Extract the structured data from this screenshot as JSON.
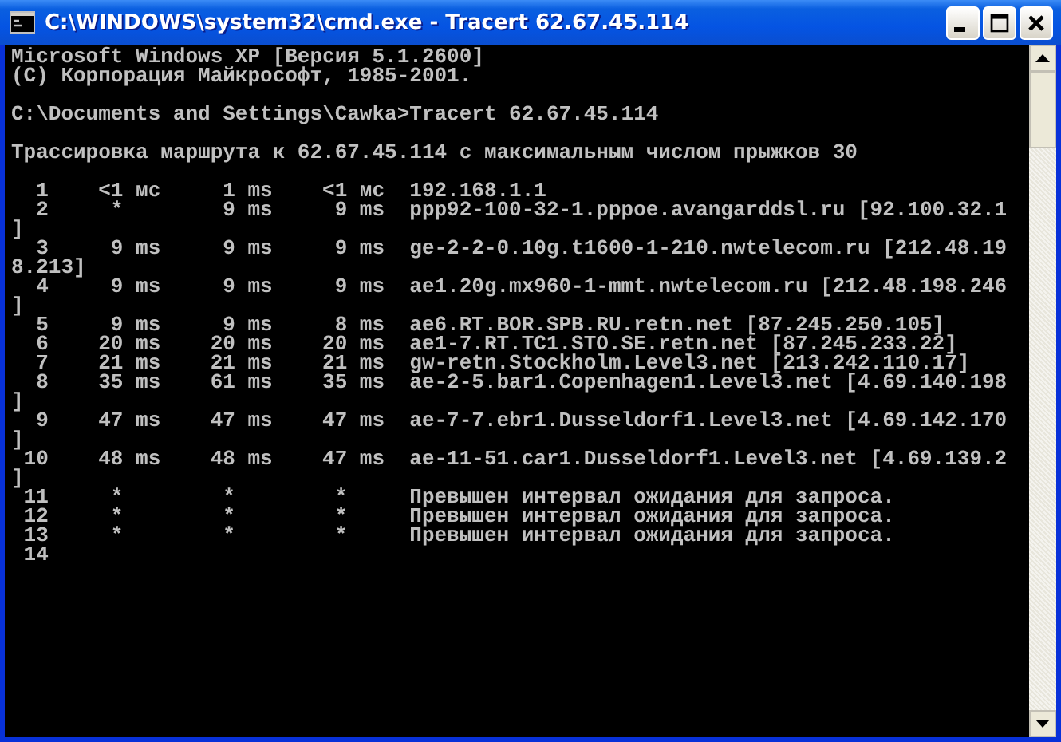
{
  "window": {
    "title": "C:\\WINDOWS\\system32\\cmd.exe - Tracert 62.67.45.114"
  },
  "console": {
    "blocks": [
      [
        "Microsoft Windows XP [Версия 5.1.2600]",
        "(С) Корпорация Майкрософт, 1985-2001."
      ],
      [
        "C:\\Documents and Settings\\Cawka>Tracert 62.67.45.114"
      ],
      [
        "Трассировка маршрута к 62.67.45.114 с максимальным числом прыжков 30"
      ],
      [
        "  1    <1 мс     1 ms    <1 мс  192.168.1.1",
        "  2     *        9 ms     9 ms  ppp92-100-32-1.pppoe.avangarddsl.ru [92.100.32.1",
        "]",
        "  3     9 ms     9 ms     9 ms  ge-2-2-0.10g.t1600-1-210.nwtelecom.ru [212.48.19",
        "8.213]",
        "  4     9 ms     9 ms     9 ms  ae1.20g.mx960-1-mmt.nwtelecom.ru [212.48.198.246",
        "]",
        "  5     9 ms     9 ms     8 ms  ae6.RT.BOR.SPB.RU.retn.net [87.245.250.105]",
        "  6    20 ms    20 ms    20 ms  ae1-7.RT.TC1.STO.SE.retn.net [87.245.233.22]",
        "  7    21 ms    21 ms    21 ms  gw-retn.Stockholm.Level3.net [213.242.110.17]",
        "  8    35 ms    61 ms    35 ms  ae-2-5.bar1.Copenhagen1.Level3.net [4.69.140.198",
        "]",
        "  9    47 ms    47 ms    47 ms  ae-7-7.ebr1.Dusseldorf1.Level3.net [4.69.142.170",
        "]",
        " 10    48 ms    48 ms    47 ms  ae-11-51.car1.Dusseldorf1.Level3.net [4.69.139.2",
        "]",
        " 11     *        *        *     Превышен интервал ожидания для запроса.",
        " 12     *        *        *     Превышен интервал ожидания для запроса.",
        " 13     *        *        *     Превышен интервал ожидания для запроса.",
        " 14"
      ]
    ]
  }
}
